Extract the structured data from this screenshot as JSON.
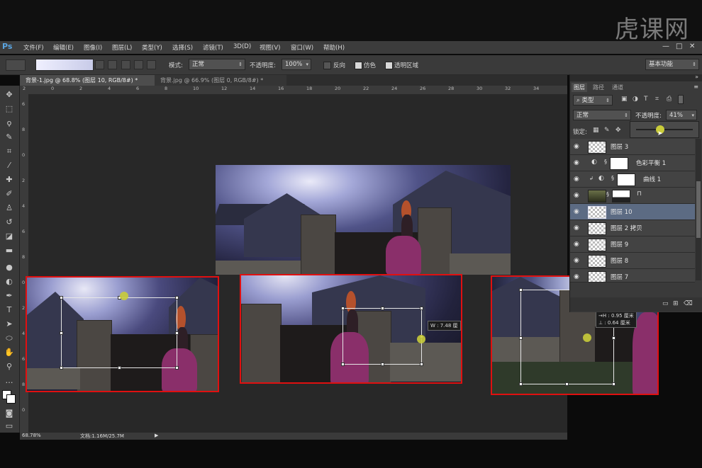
{
  "watermark": {
    "text": "虎课网"
  },
  "menubar": {
    "app_logo": "Ps",
    "items": [
      "文件(F)",
      "编辑(E)",
      "图像(I)",
      "图层(L)",
      "类型(Y)",
      "选择(S)",
      "滤镜(T)",
      "3D(D)",
      "视图(V)",
      "窗口(W)",
      "帮助(H)"
    ],
    "window_controls": [
      "—",
      "□",
      "✕"
    ]
  },
  "options": {
    "mode_label": "模式:",
    "mode_value": "正常",
    "opacity_label": "不透明度:",
    "opacity_value": "100%",
    "reverse_label": "反向",
    "dither_label": "仿色",
    "transparency_label": "透明区域",
    "workspace_value": "基本功能"
  },
  "tabs": [
    {
      "label": "背景-1.jpg @ 68.8% (图层 10, RGB/8#) *",
      "active": true
    },
    {
      "label": "背景.jpg @ 66.9% (图层 0, RGB/8#) *",
      "active": false
    }
  ],
  "rulers": {
    "top": [
      "2",
      "0",
      "2",
      "4",
      "6",
      "8",
      "10",
      "12",
      "14",
      "16",
      "18",
      "20",
      "22",
      "24",
      "26",
      "28",
      "30",
      "32",
      "34"
    ],
    "left": [
      "6",
      "8",
      "0",
      "2",
      "4",
      "6",
      "8",
      "0",
      "2",
      "4",
      "6",
      "8",
      "0"
    ]
  },
  "status": {
    "zoom": "68.78%",
    "doc": "文档:1.16M/25.7M"
  },
  "layers_panel": {
    "tabs": [
      "图层",
      "路径",
      "通道"
    ],
    "filter_label": "类型",
    "blend_mode": "正常",
    "opacity_label": "不透明度:",
    "opacity_value": "41%",
    "lock_label": "锁定:",
    "layers": [
      {
        "name": "图层 3",
        "type": "pixel",
        "selected": false
      },
      {
        "name": "色彩平衡 1",
        "type": "adjustment",
        "selected": false
      },
      {
        "name": "曲线 1",
        "type": "adjustment",
        "selected": false
      },
      {
        "name": "",
        "type": "image",
        "selected": false
      },
      {
        "name": "图层 10",
        "type": "pixel",
        "selected": true
      },
      {
        "name": "图层 2 拷贝",
        "type": "pixel",
        "selected": false
      },
      {
        "name": "图层 9",
        "type": "pixel",
        "selected": false
      },
      {
        "name": "图层 8",
        "type": "pixel",
        "selected": false
      },
      {
        "name": "图层 7",
        "type": "pixel",
        "selected": false
      }
    ]
  },
  "overlays": {
    "width_readout": "W : 7.48 厘",
    "offset_readout_h": "→H : 0.95 厘米",
    "offset_readout_v": "⊥ : 0.64 厘米"
  },
  "colors": {
    "highlight_box": "#e01010",
    "selected_layer": "#5c6b83",
    "accent": "#5aa4e0"
  }
}
